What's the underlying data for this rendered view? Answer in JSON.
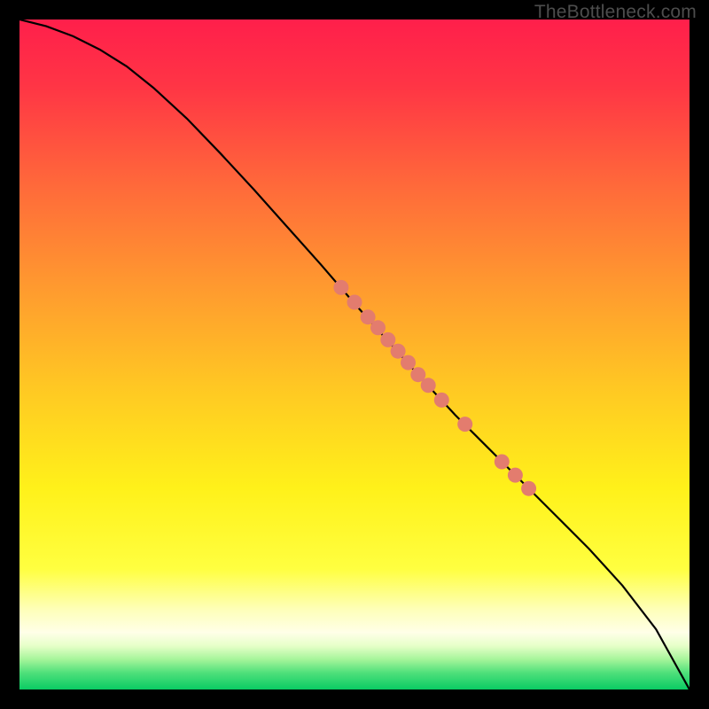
{
  "attribution": "TheBottleneck.com",
  "colors": {
    "gradient_stops_top_to_bottom": [
      {
        "pct": 0.0,
        "hex": "#ff1f4b"
      },
      {
        "pct": 10.0,
        "hex": "#ff3545"
      },
      {
        "pct": 25.0,
        "hex": "#ff6a3a"
      },
      {
        "pct": 40.0,
        "hex": "#ff9a2f"
      },
      {
        "pct": 55.0,
        "hex": "#ffc823"
      },
      {
        "pct": 70.0,
        "hex": "#fff11a"
      },
      {
        "pct": 82.0,
        "hex": "#ffff40"
      },
      {
        "pct": 88.0,
        "hex": "#feffb8"
      },
      {
        "pct": 91.5,
        "hex": "#ffffe8"
      },
      {
        "pct": 93.5,
        "hex": "#e6ffc8"
      },
      {
        "pct": 95.5,
        "hex": "#a6f59a"
      },
      {
        "pct": 97.5,
        "hex": "#4fe07b"
      },
      {
        "pct": 100.0,
        "hex": "#0acb63"
      }
    ],
    "curve": "#000000",
    "marker": "#e37c6e",
    "frame": "#000000"
  },
  "plot_extent": {
    "xmin": 0,
    "xmax": 100,
    "ymin": 0,
    "ymax": 100
  },
  "chart_data": {
    "type": "line",
    "title": "",
    "xlabel": "",
    "ylabel": "",
    "xlim": [
      0,
      100
    ],
    "ylim": [
      0,
      100
    ],
    "legend": [],
    "series": [
      {
        "name": "curve",
        "x": [
          0,
          4,
          8,
          12,
          16,
          20,
          25,
          30,
          35,
          40,
          45,
          50,
          55,
          60,
          65,
          70,
          75,
          80,
          85,
          90,
          95,
          100
        ],
        "y": [
          100.0,
          99.0,
          97.5,
          95.5,
          93.0,
          89.8,
          85.2,
          80.0,
          74.6,
          69.0,
          63.4,
          57.6,
          52.0,
          46.4,
          41.0,
          36.0,
          31.0,
          26.0,
          21.0,
          15.5,
          9.0,
          0.0
        ]
      }
    ],
    "markers": [
      {
        "x": 48.0,
        "y": 60.0
      },
      {
        "x": 50.0,
        "y": 57.8
      },
      {
        "x": 52.0,
        "y": 55.6
      },
      {
        "x": 53.5,
        "y": 54.0
      },
      {
        "x": 55.0,
        "y": 52.2
      },
      {
        "x": 56.5,
        "y": 50.5
      },
      {
        "x": 58.0,
        "y": 48.8
      },
      {
        "x": 59.5,
        "y": 47.0
      },
      {
        "x": 61.0,
        "y": 45.4
      },
      {
        "x": 63.0,
        "y": 43.2
      },
      {
        "x": 66.5,
        "y": 39.6
      },
      {
        "x": 72.0,
        "y": 34.0
      },
      {
        "x": 74.0,
        "y": 32.0
      },
      {
        "x": 76.0,
        "y": 30.0
      }
    ]
  }
}
